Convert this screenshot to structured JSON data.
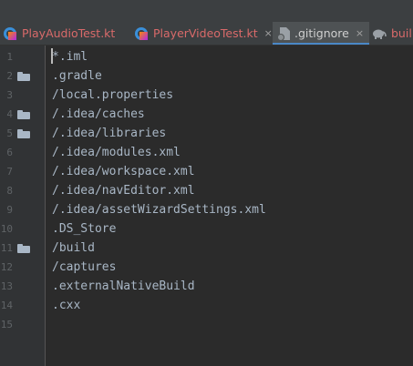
{
  "tabs": [
    {
      "label": "PlayAudioTest.kt",
      "icon": "kotlin-file-icon"
    },
    {
      "label": "PlayerVideoTest.kt",
      "icon": "kotlin-file-icon",
      "close": "×"
    },
    {
      "label": ".gitignore",
      "icon": "ignore-file-icon",
      "close": "×",
      "active": true
    },
    {
      "label": "buil",
      "icon": "gradle-elephant-icon"
    }
  ],
  "editor": {
    "lines": [
      {
        "number": "1",
        "text": "*.iml",
        "folder": false
      },
      {
        "number": "2",
        "text": ".gradle",
        "folder": true
      },
      {
        "number": "3",
        "text": "/local.properties",
        "folder": false
      },
      {
        "number": "4",
        "text": "/.idea/caches",
        "folder": true
      },
      {
        "number": "5",
        "text": "/.idea/libraries",
        "folder": true
      },
      {
        "number": "6",
        "text": "/.idea/modules.xml",
        "folder": false
      },
      {
        "number": "7",
        "text": "/.idea/workspace.xml",
        "folder": false
      },
      {
        "number": "8",
        "text": "/.idea/navEditor.xml",
        "folder": false
      },
      {
        "number": "9",
        "text": "/.idea/assetWizardSettings.xml",
        "folder": false
      },
      {
        "number": "10",
        "text": ".DS_Store",
        "folder": false
      },
      {
        "number": "11",
        "text": "/build",
        "folder": true
      },
      {
        "number": "12",
        "text": "/captures",
        "folder": false
      },
      {
        "number": "13",
        "text": ".externalNativeBuild",
        "folder": false
      },
      {
        "number": "14",
        "text": ".cxx",
        "folder": false
      },
      {
        "number": "15",
        "text": "",
        "folder": false
      }
    ]
  },
  "colors": {
    "tab_inactive_text": "#d96a6a",
    "tab_active_underline": "#4a88c7",
    "editor_bg": "#2b2b2b",
    "gutter_bg": "#313335",
    "code_text": "#a9b7c6"
  }
}
